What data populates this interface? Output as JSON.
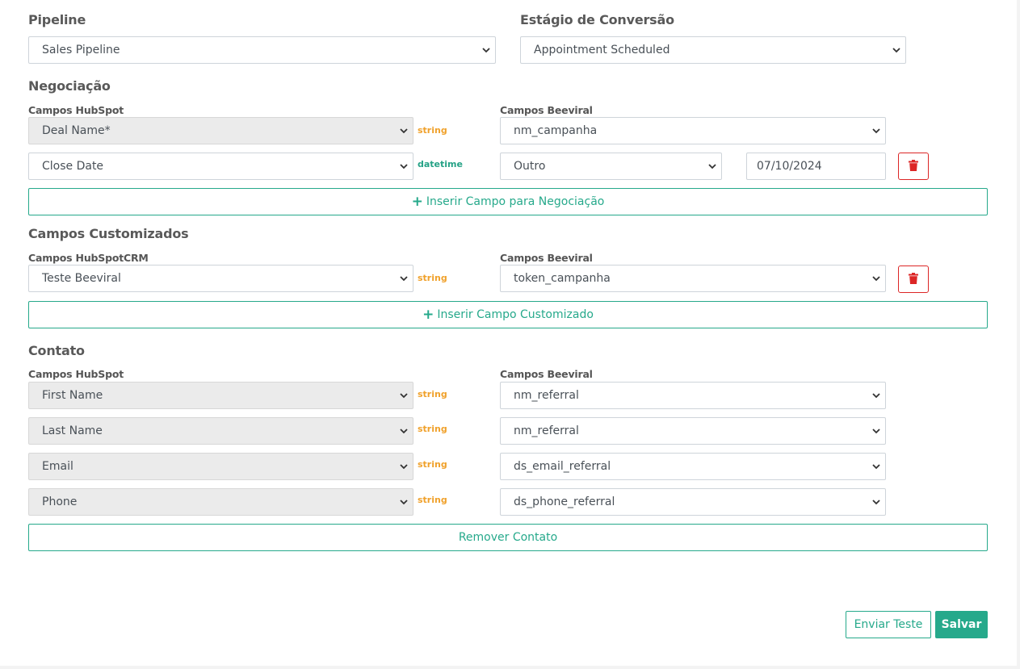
{
  "pipeline": {
    "label": "Pipeline",
    "selected": "Sales Pipeline"
  },
  "conversion_stage": {
    "label": "Estágio de Conversão",
    "selected": "Appointment Scheduled"
  },
  "negotiation": {
    "title": "Negociação",
    "col_hubspot": "Campos HubSpot",
    "col_beeviral": "Campos Beeviral",
    "rows": [
      {
        "hubspot": "Deal Name*",
        "type": "string",
        "beeviral": "nm_campanha"
      },
      {
        "hubspot": "Close Date",
        "type": "datetime",
        "beeviral": "Outro",
        "extra_value": "07/10/2024"
      }
    ],
    "add_button": "Inserir Campo para Negociação"
  },
  "custom_fields": {
    "title": "Campos Customizados",
    "col_hubspot": "Campos HubSpotCRM",
    "col_beeviral": "Campos Beeviral",
    "rows": [
      {
        "hubspot": "Teste Beeviral",
        "type": "string",
        "beeviral": "token_campanha"
      }
    ],
    "add_button": "Inserir Campo Customizado"
  },
  "contact": {
    "title": "Contato",
    "col_hubspot": "Campos HubSpot",
    "col_beeviral": "Campos Beeviral",
    "rows": [
      {
        "hubspot": "First Name",
        "type": "string",
        "beeviral": "nm_referral"
      },
      {
        "hubspot": "Last Name",
        "type": "string",
        "beeviral": "nm_referral"
      },
      {
        "hubspot": "Email",
        "type": "string",
        "beeviral": "ds_email_referral"
      },
      {
        "hubspot": "Phone",
        "type": "string",
        "beeviral": "ds_phone_referral"
      }
    ],
    "remove_button": "Remover Contato"
  },
  "footer": {
    "send_test": "Enviar Teste",
    "save": "Salvar"
  },
  "colors": {
    "accent": "#26a98b",
    "danger": "#dc2626",
    "string_type": "#f0a12b",
    "datetime_type": "#25a286"
  },
  "icons": {
    "dropdown": "chevron-down-icon",
    "delete": "trash-icon",
    "add": "plus-icon"
  }
}
